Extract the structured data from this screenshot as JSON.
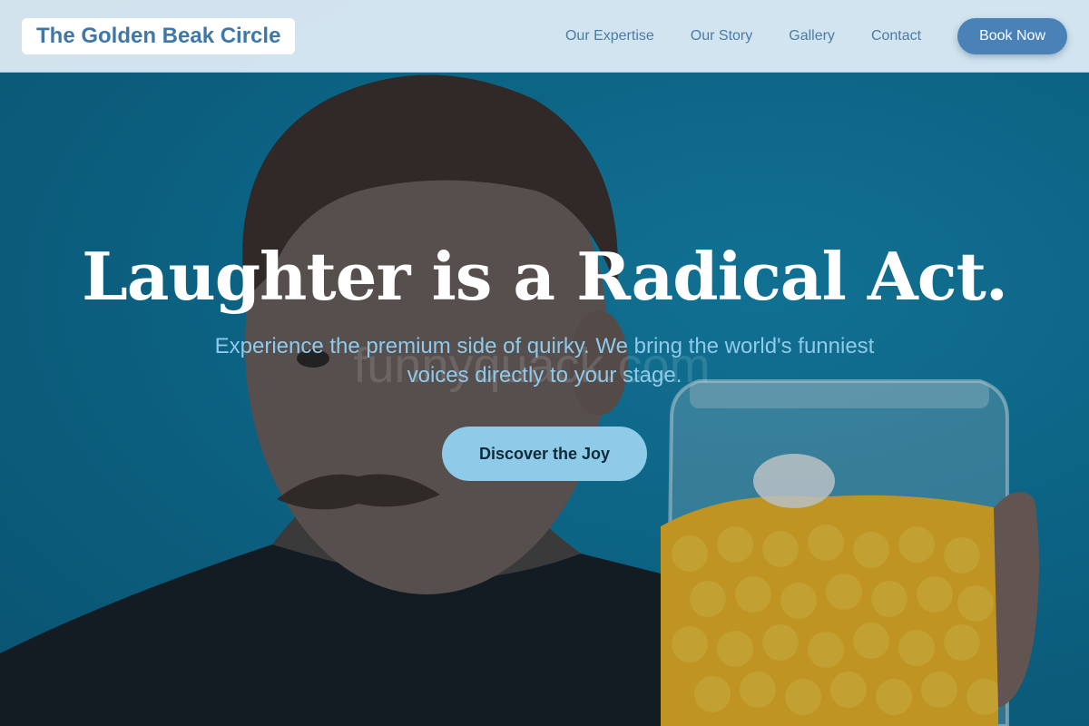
{
  "header": {
    "logo": "The Golden Beak Circle",
    "nav": [
      "Our Expertise",
      "Our Story",
      "Gallery",
      "Contact"
    ],
    "cta": "Book Now"
  },
  "hero": {
    "headline": "Laughter is a Radical Act.",
    "subheadline": "Experience the premium side of quirky. We bring the world's funniest voices directly to your stage.",
    "cta": "Discover the Joy",
    "watermark": "funnyquack.com"
  },
  "colors": {
    "accent": "#4a82b8",
    "cta_light": "#8ecbe9",
    "background_teal": "#0e7499",
    "header_bg": "#e2eef7"
  }
}
